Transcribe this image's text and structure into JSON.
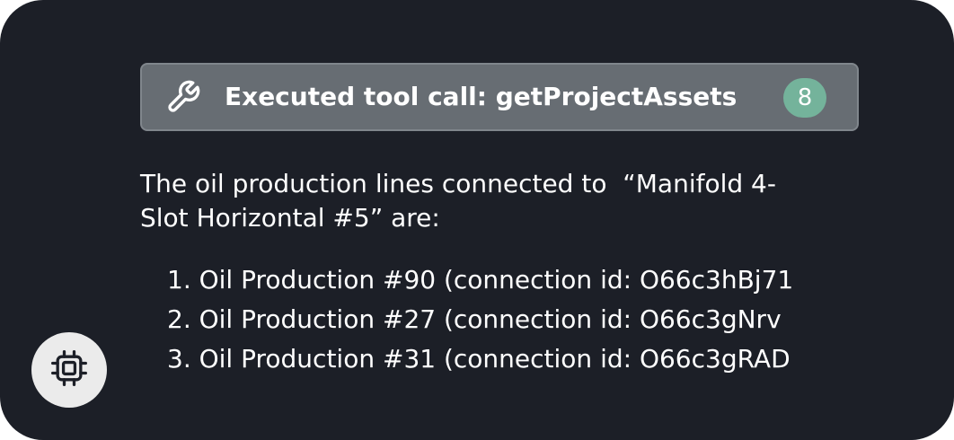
{
  "tool_call": {
    "label": "Executed tool call: getProjectAssets",
    "count": "8",
    "icon": "wrench-icon"
  },
  "message": {
    "intro_line_1": "The oil production lines connected to  “Manifold 4-",
    "intro_line_2": "Slot Horizontal #5” are:",
    "items": [
      "1. Oil Production #90 (connection id: O66c3hBj71",
      "2. Oil Production #27 (connection id: O66c3gNrv",
      "3. Oil Production #31 (connection id: O66c3gRAD"
    ]
  },
  "assistant_avatar": {
    "icon": "chip-icon"
  },
  "colors": {
    "card_background": "#1c1f27",
    "pill_background": "#676d73",
    "badge_background": "#74b39b",
    "avatar_background": "#ebebeb"
  }
}
